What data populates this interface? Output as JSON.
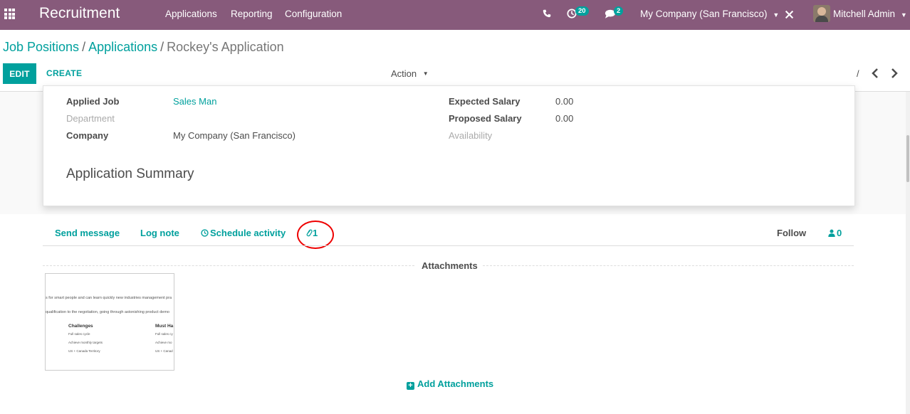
{
  "topbar": {
    "app_name": "Recruitment",
    "menu": [
      "Applications",
      "Reporting",
      "Configuration"
    ],
    "activity_count": "20",
    "message_count": "2",
    "company": "My Company (San Francisco)",
    "user": "Mitchell Admin"
  },
  "breadcrumb": {
    "items": [
      "Job Positions",
      "Applications"
    ],
    "separator": "/",
    "current": "Rockey's Application"
  },
  "controlpanel": {
    "edit_label": "EDIT",
    "create_label": "CREATE",
    "action_label": "Action",
    "pager": "/"
  },
  "form": {
    "left": [
      {
        "label": "Applied Job",
        "value": "Sales Man"
      },
      {
        "label": "Department",
        "value": ""
      },
      {
        "label": "Company",
        "value": "My Company (San Francisco)"
      }
    ],
    "right": [
      {
        "label": "Expected Salary",
        "value": "0.00"
      },
      {
        "label": "Proposed Salary",
        "value": "0.00"
      },
      {
        "label": "Availability",
        "value": ""
      }
    ],
    "summary_title": "Application Summary"
  },
  "chatter": {
    "send_message": "Send message",
    "log_note": "Log note",
    "schedule_activity": "Schedule activity",
    "attachment_count": "1",
    "follow": "Follow",
    "followers_count": "0",
    "attachments_title": "Attachments",
    "add_attachments": "Add Attachments"
  },
  "attachment_preview": {
    "line1": "s for smart people and can learn quickly new industries management pra",
    "line2": "qualification to the negotiation, going through astonishing product demo",
    "col1_title": "Challenges",
    "col1_items": [
      "Full sales cycle",
      "Achieve monthly targets",
      "US + Canada Territory"
    ],
    "col2_title": "Must Ha",
    "col2_items": [
      "Full sales cy",
      "Achieve mo",
      "US + Canad"
    ]
  },
  "colors": {
    "brand": "#875a7b",
    "accent": "#00a09d",
    "highlight_circle": "#ee0000"
  }
}
